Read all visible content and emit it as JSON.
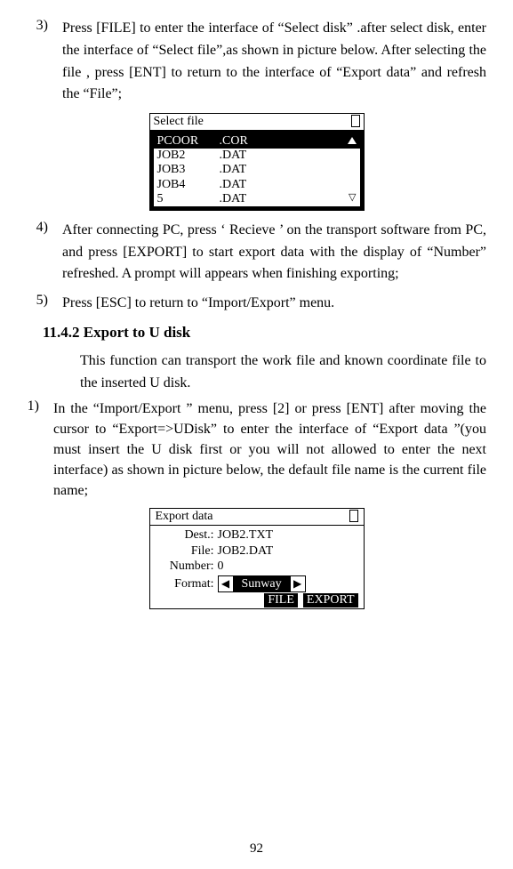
{
  "steps": {
    "s3": {
      "marker": "3)",
      "text": "Press [FILE] to enter the interface of “Select disk” .after select disk, enter the interface of “Select file”,as shown in picture below. After selecting the file , press [ENT] to return to the interface of “Export data” and refresh the “File”;"
    },
    "s4": {
      "marker": "4)",
      "text": "After connecting PC, press ‘ Recieve ’ on the transport software from PC, and press [EXPORT] to start export data with the display of “Number” refreshed. A prompt will appears when finishing exporting;"
    },
    "s5": {
      "marker": "5)",
      "text": "Press [ESC] to return to “Import/Export” menu."
    },
    "s1b": {
      "marker": "1)",
      "text": "In the “Import/Export ” menu, press [2] or press [ENT] after moving the cursor to “Export=>UDisk” to enter the interface of “Export data ”(you must insert the U disk first or you will not allowed to enter the next interface) as shown in picture below, the default file name is the current file name;"
    }
  },
  "section_heading": "11.4.2 Export to U disk",
  "section_intro": "This function can transport the work file and known coordinate file to the inserted U disk.",
  "select_file": {
    "title": "Select file",
    "rows": [
      {
        "name": "PCOOR",
        "ext": ".COR",
        "selected": true
      },
      {
        "name": "JOB2",
        "ext": ".DAT",
        "selected": false
      },
      {
        "name": "JOB3",
        "ext": ".DAT",
        "selected": false
      },
      {
        "name": "JOB4",
        "ext": ".DAT",
        "selected": false
      },
      {
        "name": "5",
        "ext": ".DAT",
        "selected": false
      }
    ]
  },
  "export_data": {
    "title": "Export data",
    "labels": {
      "dest": "Dest.:",
      "file": "File:",
      "number": "Number:",
      "format": "Format:"
    },
    "values": {
      "dest": "JOB2.TXT",
      "file": "JOB2.DAT",
      "number": "0",
      "format": "Sunway"
    },
    "buttons": {
      "file": "FILE",
      "export": "EXPORT"
    }
  },
  "page_number": "92"
}
